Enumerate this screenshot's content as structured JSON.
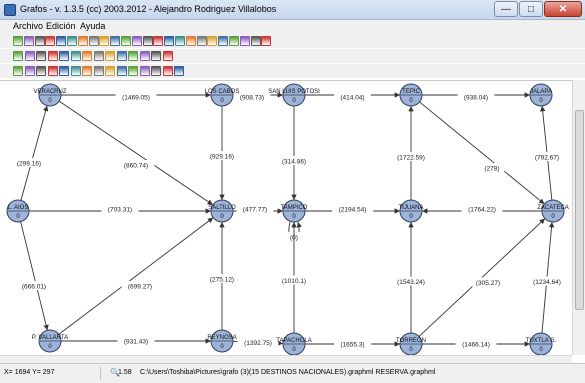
{
  "window": {
    "title": "Grafos - v. 1.3.5  (cc) 2003.2012 - Alejandro Rodriguez Villalobos",
    "minimize": "—",
    "maximize": "□",
    "close": "✕"
  },
  "menu": [
    "Archivo",
    "Edición",
    "Ayuda"
  ],
  "icons": {
    "toolbar1": [
      "new-icon",
      "select-icon",
      "arrow-icon",
      "undo-icon",
      "edit-icon",
      "edge-icon",
      "node-icon",
      "filter-icon",
      "edge-label-icon",
      "directed-icon",
      "undirected-icon",
      "weight-icon",
      "flag-icon",
      "graph-icon",
      "table-icon",
      "grid-icon",
      "zoom-icon",
      "zoom-in-icon",
      "zoom-out-icon",
      "zoom-fit-icon",
      "fullscreen-icon",
      "help-icon",
      "info-icon",
      "car-icon"
    ],
    "toolbar2": [
      "save-icon",
      "copy-icon",
      "export-icon",
      "matrix-icon",
      "matrix-icon",
      "matrix-icon",
      "matrix-icon",
      "matrix-icon",
      "matrix-icon",
      "matrix-icon",
      "matrix-icon",
      "shape-icon",
      "shape-icon",
      "shape-icon"
    ],
    "toolbar3": [
      "layout-icon",
      "layout-icon",
      "node-style-icon",
      "color-icon",
      "box-icon",
      "line-icon",
      "line-icon",
      "line-icon",
      "curve-icon",
      "curve-icon",
      "arc-icon",
      "arc-icon",
      "arc-icon",
      "arc-icon",
      "grid-icon"
    ]
  },
  "graph": {
    "nodes": [
      {
        "id": "veracruz",
        "label": "VERACRUZ",
        "value": "0"
      },
      {
        "id": "los-cabos",
        "label": "LOS CABOS",
        "value": "0"
      },
      {
        "id": "san-luis-potosi",
        "label": "SAN LUIS POTOSI",
        "value": "0"
      },
      {
        "id": "tepic",
        "label": "TEPIC",
        "value": "0"
      },
      {
        "id": "jalapa",
        "label": "JALAPA",
        "value": "0"
      },
      {
        "id": "l-aios",
        "label": "L. AIOS",
        "value": "0"
      },
      {
        "id": "saltillo",
        "label": "SALTILLO",
        "value": "0"
      },
      {
        "id": "tampico",
        "label": "TAMPICO",
        "value": "0"
      },
      {
        "id": "tijuana",
        "label": "TIJUANA",
        "value": "0"
      },
      {
        "id": "zacatecas",
        "label": "ZACATECA",
        "value": "0"
      },
      {
        "id": "p-vallarta",
        "label": "P. VALLARTA",
        "value": "0"
      },
      {
        "id": "reynosa",
        "label": "REYNOSA",
        "value": "0"
      },
      {
        "id": "tapachula",
        "label": "TAPACHOLA",
        "value": "0"
      },
      {
        "id": "torreon",
        "label": "TORREON",
        "value": "0"
      },
      {
        "id": "tuxtla",
        "label": "TUXTLA G.",
        "value": "0"
      }
    ],
    "edges": [
      {
        "from": "veracruz",
        "to": "los-cabos",
        "label": "(1469.05)"
      },
      {
        "from": "los-cabos",
        "to": "san-luis-potosi",
        "label": "(908.73)"
      },
      {
        "from": "san-luis-potosi",
        "to": "tepic",
        "label": "(414.04)"
      },
      {
        "from": "tepic",
        "to": "jalapa",
        "label": "(938.04)"
      },
      {
        "from": "l-aios",
        "to": "veracruz",
        "label": "(299.16)"
      },
      {
        "from": "veracruz",
        "to": "saltillo",
        "label": "(860.74)"
      },
      {
        "from": "los-cabos",
        "to": "saltillo",
        "label": "(929.16)"
      },
      {
        "from": "san-luis-potosi",
        "to": "tampico",
        "label": "(314.86)"
      },
      {
        "from": "tijuana",
        "to": "tepic",
        "label": "(1722.59)"
      },
      {
        "from": "tepic",
        "to": "zacatecas",
        "label": "(278)"
      },
      {
        "from": "zacatecas",
        "to": "jalapa",
        "label": "(792.67)"
      },
      {
        "from": "l-aios",
        "to": "saltillo",
        "label": "(703.31)"
      },
      {
        "from": "saltillo",
        "to": "tampico",
        "label": "(477.77)"
      },
      {
        "from": "tampico",
        "to": "tijuana",
        "label": "(2194.54)"
      },
      {
        "from": "zacatecas",
        "to": "tijuana",
        "label": "(1764.22)"
      },
      {
        "from": "tampico",
        "to": "tampico",
        "label": "(0)"
      },
      {
        "from": "l-aios",
        "to": "p-vallarta",
        "label": "(666.01)"
      },
      {
        "from": "p-vallarta",
        "to": "saltillo",
        "label": "(699.27)"
      },
      {
        "from": "reynosa",
        "to": "saltillo",
        "label": "(275.12)"
      },
      {
        "from": "tapachula",
        "to": "tampico",
        "label": "(1010.1)"
      },
      {
        "from": "torreon",
        "to": "tijuana",
        "label": "(1543.24)"
      },
      {
        "from": "torreon",
        "to": "zacatecas",
        "label": "(305.27)"
      },
      {
        "from": "tuxtla",
        "to": "zacatecas",
        "label": "(1234.64)"
      },
      {
        "from": "p-vallarta",
        "to": "reynosa",
        "label": "(931.43)"
      },
      {
        "from": "reynosa",
        "to": "tapachula",
        "label": "(1392.75)"
      },
      {
        "from": "tapachula",
        "to": "torreon",
        "label": "(1655.3)"
      },
      {
        "from": "torreon",
        "to": "tuxtla",
        "label": "(1466.14)"
      }
    ]
  },
  "status": {
    "coords": "X= 1694 Y= 297",
    "zoom": "1.58",
    "path": "C:\\Users\\Toshiba\\Pictures\\grafo (3)(15 DESTINOS NACIONALES).graphml RESERVA.graphml"
  },
  "colors": {
    "node_fill": "#9db3d8",
    "node_stroke": "#2f3f5f",
    "edge": "#333333"
  }
}
